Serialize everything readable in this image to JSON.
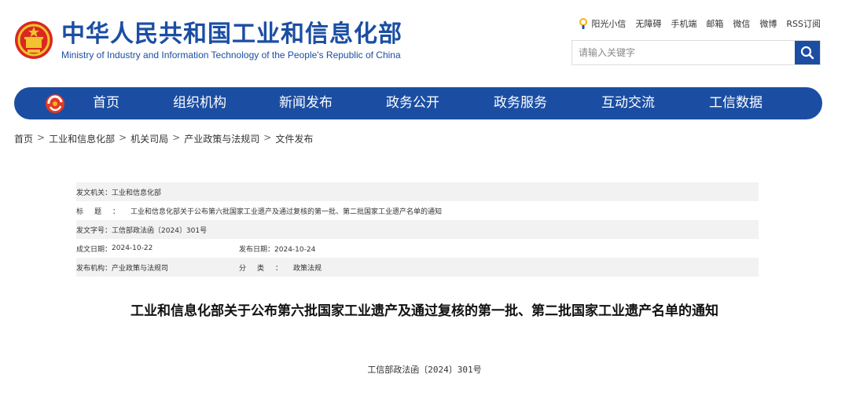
{
  "header": {
    "title": "中华人民共和国工业和信息化部",
    "subtitle": "Ministry of Industry and Information Technology of the People's Republic of China",
    "brand_color": "#1b4ea3",
    "emblem_icon": "national-emblem-icon"
  },
  "toplinks": [
    {
      "label": "阳光小信",
      "icon": "sun-mascot-icon"
    },
    {
      "label": "无障碍"
    },
    {
      "label": "手机端"
    },
    {
      "label": "邮箱"
    },
    {
      "label": "微信"
    },
    {
      "label": "微博"
    },
    {
      "label": "RSS订阅"
    }
  ],
  "search": {
    "placeholder": "请输入关键字",
    "value": "",
    "icon": "search-icon"
  },
  "nav": {
    "logo_icon": "miit-logo-icon",
    "items": [
      "首页",
      "组织机构",
      "新闻发布",
      "政务公开",
      "政务服务",
      "互动交流",
      "工信数据"
    ]
  },
  "breadcrumb": {
    "items": [
      "首页",
      "工业和信息化部",
      "机关司局",
      "产业政策与法规司",
      "文件发布"
    ],
    "separator": ">"
  },
  "info": {
    "issuer_label": "发文机关：",
    "issuer": "工业和信息化部",
    "title_label": "标题：",
    "title": "工业和信息化部关于公布第六批国家工业遗产及通过复核的第一批、第二批国家工业遗产名单的通知",
    "doc_no_label": "发文字号：",
    "doc_no": "工信部政法函〔2024〕301号",
    "written_date_label": "成文日期：",
    "written_date": "2024-10-22",
    "publish_date_label": "发布日期：",
    "publish_date": "2024-10-24",
    "org_label": "发布机构：",
    "org": "产业政策与法规司",
    "category_label": "分类：",
    "category": "政策法规"
  },
  "article": {
    "title": "工业和信息化部关于公布第六批国家工业遗产及通过复核的第一批、第二批国家工业遗产名单的通知",
    "doc_number": "工信部政法函〔2024〕301号"
  }
}
